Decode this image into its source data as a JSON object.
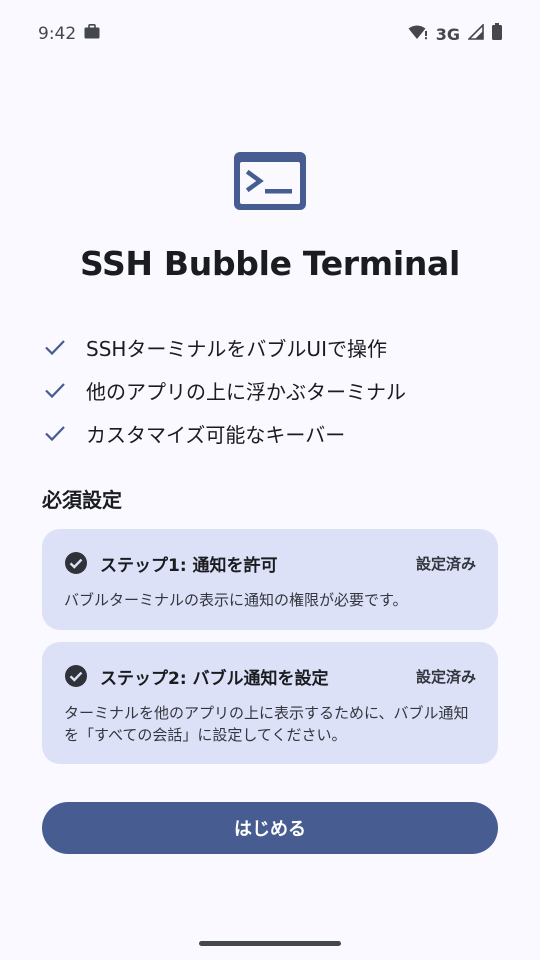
{
  "status_bar": {
    "time": "9:42",
    "network": "3G"
  },
  "app": {
    "title": "SSH Bubble Terminal",
    "icon": "terminal-icon",
    "accent_color": "#475d92"
  },
  "features": [
    {
      "label": "SSHターミナルをバブルUIで操作"
    },
    {
      "label": "他のアプリの上に浮かぶターミナル"
    },
    {
      "label": "カスタマイズ可能なキーバー"
    }
  ],
  "setup": {
    "section_title": "必須設定",
    "steps": [
      {
        "title": "ステップ1: 通知を許可",
        "status": "設定済み",
        "description": "バブルターミナルの表示に通知の権限が必要です。"
      },
      {
        "title": "ステップ2: バブル通知を設定",
        "status": "設定済み",
        "description": "ターミナルを他のアプリの上に表示するために、バブル通知を「すべての会話」に設定してください。"
      }
    ]
  },
  "start_button": {
    "label": "はじめる"
  }
}
